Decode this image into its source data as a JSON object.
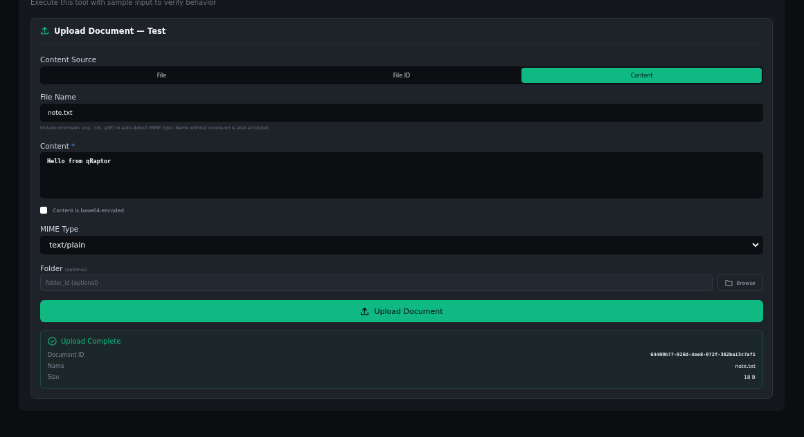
{
  "subtitle": "Execute this tool with sample input to verify behavior",
  "card": {
    "title": "Upload Document — Test"
  },
  "content_source": {
    "label": "Content Source",
    "tabs": [
      {
        "label": "File",
        "selected": false
      },
      {
        "label": "File ID",
        "selected": false
      },
      {
        "label": "Content",
        "selected": true
      }
    ]
  },
  "file_name": {
    "label": "File Name",
    "value": "note.txt",
    "help": "Include extension (e.g. .txt, .pdf) to auto-detect MIME type. Name without extension is also accepted."
  },
  "content": {
    "label": "Content",
    "required_mark": "*",
    "value": "Hello from qRaptor"
  },
  "base64": {
    "label": "Content is base64-encoded",
    "checked": false
  },
  "mime_type": {
    "label": "MIME Type",
    "value": "text/plain"
  },
  "folder": {
    "label": "Folder",
    "hint": "(optional)",
    "placeholder": "folder_id (optional)",
    "browse": "Browse"
  },
  "upload_button": "Upload Document",
  "result": {
    "title": "Upload Complete",
    "rows": [
      {
        "label": "Document ID",
        "value": "64409b77-926d-4ee8-972f-382ba13c7af1",
        "kind": "mono"
      },
      {
        "label": "Name",
        "value": "note.txt",
        "kind": "text"
      },
      {
        "label": "Size",
        "value": "18 B",
        "kind": "text"
      }
    ]
  }
}
